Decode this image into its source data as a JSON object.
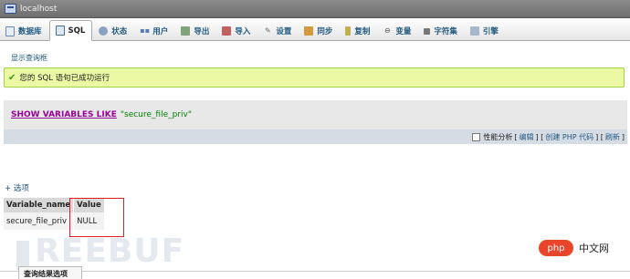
{
  "server": {
    "name": "localhost"
  },
  "tabs": [
    {
      "label": "数据库",
      "icon": "database-icon"
    },
    {
      "label": "SQL",
      "icon": "sql-icon",
      "active": true
    },
    {
      "label": "状态",
      "icon": "status-icon"
    },
    {
      "label": "用户",
      "icon": "users-icon"
    },
    {
      "label": "导出",
      "icon": "export-icon"
    },
    {
      "label": "导入",
      "icon": "import-icon"
    },
    {
      "label": "设置",
      "icon": "settings-icon"
    },
    {
      "label": "同步",
      "icon": "sync-icon"
    },
    {
      "label": "复制",
      "icon": "replicate-icon"
    },
    {
      "label": "变量",
      "icon": "variables-icon"
    },
    {
      "label": "字符集",
      "icon": "charset-icon"
    },
    {
      "label": "引擎",
      "icon": "engines-icon"
    }
  ],
  "show_query_link": "显示查询框",
  "success_message": "您的 SQL 语句已成功运行",
  "sql": {
    "keywords": "SHOW VARIABLES LIKE",
    "string": "\"secure_file_priv\""
  },
  "query_tools": {
    "profiling_label": "性能分析",
    "open1": "[",
    "edit": "编辑",
    "sep1": "] [",
    "create_php": "创建 PHP 代码",
    "sep2": "] [",
    "refresh": "刷新",
    "close1": "]"
  },
  "options_link": "+ 选项",
  "result": {
    "columns": [
      "Variable_name",
      "Value"
    ],
    "rows": [
      [
        "secure_file_priv",
        "NULL"
      ]
    ]
  },
  "watermark": "REEBUF",
  "php_badge": "php",
  "php_site": "中文网",
  "bottom_panel_title": "查询结果选项",
  "colors": {
    "link": "#235a81",
    "success_bg": "#ebf8a4",
    "highlight_border": "#e02020",
    "keyword": "#990099",
    "string": "#008000"
  }
}
